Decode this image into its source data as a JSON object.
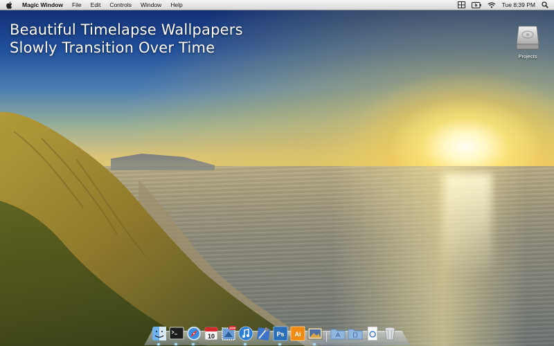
{
  "menubar": {
    "apple_icon": "apple-logo-icon",
    "app_name": "Magic Window",
    "menus": [
      "File",
      "Edit",
      "Controls",
      "Window",
      "Help"
    ],
    "status": {
      "clock": "Tue 8:39 PM"
    }
  },
  "headline": {
    "line1": "Beautiful Timelapse Wallpapers",
    "line2": "Slowly Transition Over Time"
  },
  "desktop": {
    "drive_label": "Projects"
  },
  "dock": {
    "ical_day": "10",
    "photoshop_label": "Ps",
    "illustrator_label": "Ai",
    "mail_badge": "1000"
  }
}
